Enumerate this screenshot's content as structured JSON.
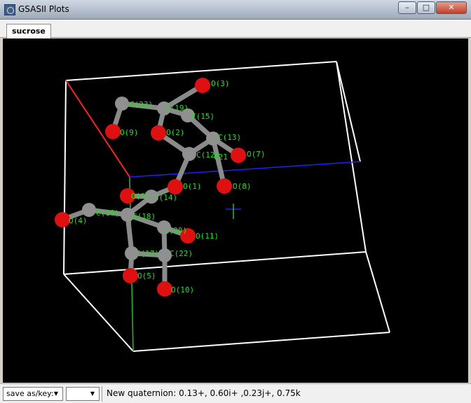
{
  "window": {
    "title": "GSASII Plots",
    "controls": [
      "minimize",
      "maximize",
      "close"
    ]
  },
  "tabs": [
    {
      "label": "sucrose",
      "selected": true
    }
  ],
  "viewer": {
    "background": "#000000",
    "atom_color_oxygen": "#e01010",
    "atom_color_carbon": "#909090",
    "label_color": "#14e814",
    "axis_colors": {
      "a": "#ff2020",
      "b": "#20c020",
      "c": "#2020ff"
    },
    "atoms": [
      {
        "label": "O(3)"
      },
      {
        "label": "C(23)"
      },
      {
        "label": "C(19)"
      },
      {
        "label": "C(15)"
      },
      {
        "label": "O(9)"
      },
      {
        "label": "O(2)"
      },
      {
        "label": "C(13)"
      },
      {
        "label": "C(12)"
      },
      {
        "label": "C21"
      },
      {
        "label": "O(7)"
      },
      {
        "label": "O(1)"
      },
      {
        "label": "O(8)"
      },
      {
        "label": "O(6)"
      },
      {
        "label": "C(14)"
      },
      {
        "label": "O(4)"
      },
      {
        "label": "C(16)"
      },
      {
        "label": "C(18)"
      },
      {
        "label": "C(20)"
      },
      {
        "label": "O(11)"
      },
      {
        "label": "C(17)"
      },
      {
        "label": "C(22)"
      },
      {
        "label": "O(5)"
      },
      {
        "label": "O(10)"
      }
    ]
  },
  "statusbar": {
    "save_label": "save as/key:",
    "second_combo_value": "",
    "message": "New quaternion: 0.13+, 0.60i+ ,0.23j+, 0.75k"
  }
}
